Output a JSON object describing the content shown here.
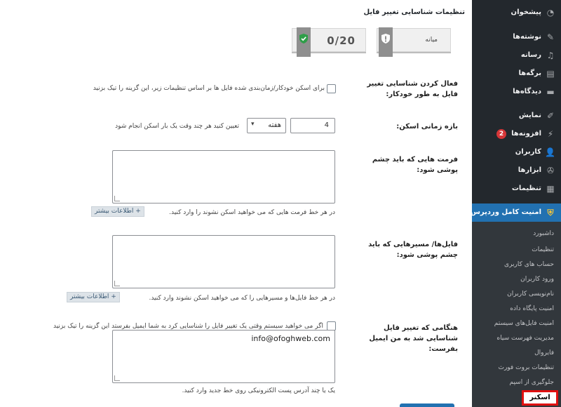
{
  "page": {
    "title": "تنظیمات شناسایی تغییر فایل"
  },
  "score": {
    "value": "0/20",
    "level_label": "میانه"
  },
  "fields": {
    "auto_scan": {
      "label": "فعال کردن شناسایی تغییر فایل به طور خودکار:",
      "checkbox_text": "برای اسکن خودکار/زمان‌بندی شده فایل ها بر اساس تنظیمات زیر، این گزینه را تیک بزنید",
      "checked": false
    },
    "scan_interval": {
      "label": "بازه زمانی اسکن:",
      "value": "4",
      "unit": "هفته",
      "help": "تعیین کنید هر چند وقت یک بار اسکن انجام شود"
    },
    "ignored_formats": {
      "label": "فرمت هایی که باید چشم پوشی شود:",
      "value": "",
      "help": "در هر خط فرمت هایی که می خواهید اسکن نشوند را وارد کنید.",
      "more_button": "+ اطلاعات بیشتر"
    },
    "ignored_paths": {
      "label": "فایل‌ها/ مسیرهایی که باید چشم پوشی شود:",
      "value": "",
      "help": "در هر خط فایل‌ها و مسیرهایی را که می خواهید اسکن نشوند وارد کنید.",
      "more_button": "+ اطلاعات بیشتر"
    },
    "email_notify": {
      "label": "هنگامی که تغییر فایل شناسایی شد به من ایمیل بفرست:",
      "checkbox_text": "اگر می خواهید سیستم وقتی یک تغییر فایل را شناسایی کرد به شما ایمیل بفرستد این گزینه را تیک بزنید",
      "checked": false,
      "email_value": "info@ofoghweb.com",
      "help": "یک یا چند آدرس پست الکترونیکی روی خط جدید وارد کنید."
    }
  },
  "sidebar": {
    "items": [
      {
        "label": "پیشخوان",
        "icon": "dashboard-icon"
      },
      {
        "label": "نوشته‌ها",
        "icon": "pin-icon"
      },
      {
        "label": "رسانه",
        "icon": "media-icon"
      },
      {
        "label": "برگه‌ها",
        "icon": "page-icon"
      },
      {
        "label": "دیدگاه‌ها",
        "icon": "comments-icon"
      },
      {
        "label": "نمایش",
        "icon": "brush-icon"
      },
      {
        "label": "افزونه‌ها",
        "icon": "plugin-icon",
        "badge": "2"
      },
      {
        "label": "کاربران",
        "icon": "users-icon"
      },
      {
        "label": "ابزارها",
        "icon": "wrench-icon"
      },
      {
        "label": "تنظیمات",
        "icon": "settings-icon"
      }
    ],
    "active": {
      "label": "امنیت کامل وردپرس",
      "icon": "shield-icon"
    },
    "submenu": [
      "داشبورد",
      "تنظیمات",
      "حساب های کاربری",
      "ورود کاربران",
      "نام‌نویسی کاربران",
      "امنیت پایگاه داده",
      "امنیت فایل‌های سیستم",
      "مدیریت فهرست سیاه",
      "فایروال",
      "تنظیمات بروت فورث",
      "جلوگیری از اسپم"
    ],
    "submenu_current": "اسکنر"
  },
  "colors": {
    "sidebar_bg": "#23282d",
    "submenu_bg": "#32373c",
    "active_blue": "#2271b1",
    "highlight_red": "#e01010",
    "badge_red": "#d63638"
  }
}
